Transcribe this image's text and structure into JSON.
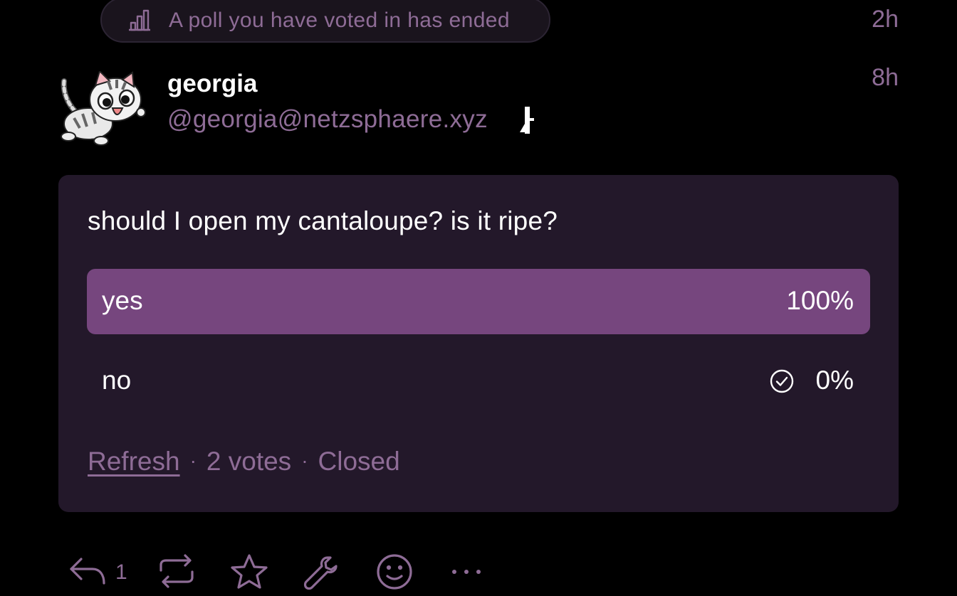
{
  "notification": {
    "icon": "poll-chart-icon",
    "text": "A poll you have voted in has ended",
    "time": "2h"
  },
  "post": {
    "display_name": "georgia",
    "handle": "@georgia@netzsphaere.xyz",
    "time": "8h",
    "avatar": "cat-avatar",
    "account_icon": "bot-account-icon"
  },
  "poll": {
    "question": "should I open my cantaloupe? is it ripe?",
    "options": [
      {
        "label": "yes",
        "percent_text": "100%",
        "fraction": 1.0,
        "voted": false
      },
      {
        "label": "no",
        "percent_text": "0%",
        "fraction": 0.0,
        "voted": true
      }
    ],
    "refresh_label": "Refresh",
    "votes_text": "2 votes",
    "status_text": "Closed",
    "separator": "·"
  },
  "actions": {
    "reply_count": "1",
    "icons": [
      "reply-icon",
      "boost-icon",
      "favourite-icon",
      "tools-icon",
      "emoji-react-icon",
      "more-icon"
    ]
  },
  "colors": {
    "background": "#000000",
    "card": "#23182a",
    "accent": "#76467e",
    "muted_text": "#8e6c96"
  }
}
